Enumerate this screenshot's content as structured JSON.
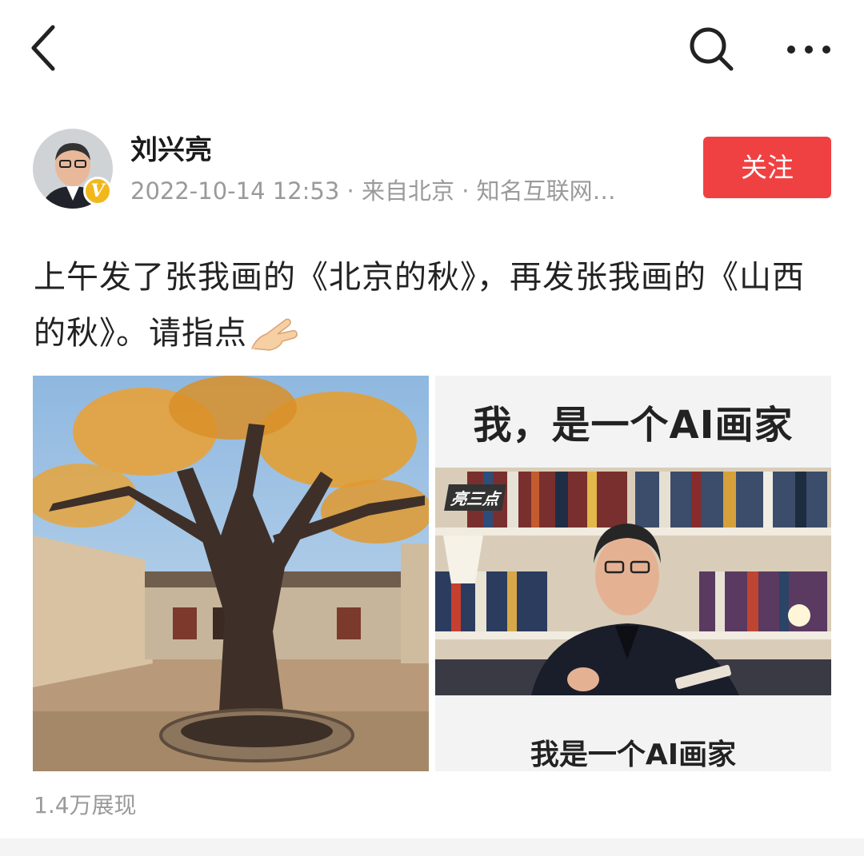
{
  "topbar": {
    "back_icon": "chevron-left-icon",
    "search_icon": "search-icon",
    "more_icon": "more-horizontal-icon"
  },
  "author": {
    "name": "刘兴亮",
    "meta": "2022-10-14 12:53 · 来自北京 · 知名互联网…",
    "badge": "V",
    "follow_label": "关注",
    "follow_color": "#f04142",
    "badge_color": "#f2b81b"
  },
  "post": {
    "text": "上午发了张我画的《北京的秋》，再发张我画的《山西的秋》。请指点",
    "emoji": "pointing-hand-emoji"
  },
  "images": {
    "left_description_icon": "tree-photo",
    "right": {
      "top_text": "我，是一个AI画家",
      "logo": "亮三点",
      "bottom_text": "我是一个AI画家"
    }
  },
  "stats": {
    "views": "1.4万展现"
  }
}
